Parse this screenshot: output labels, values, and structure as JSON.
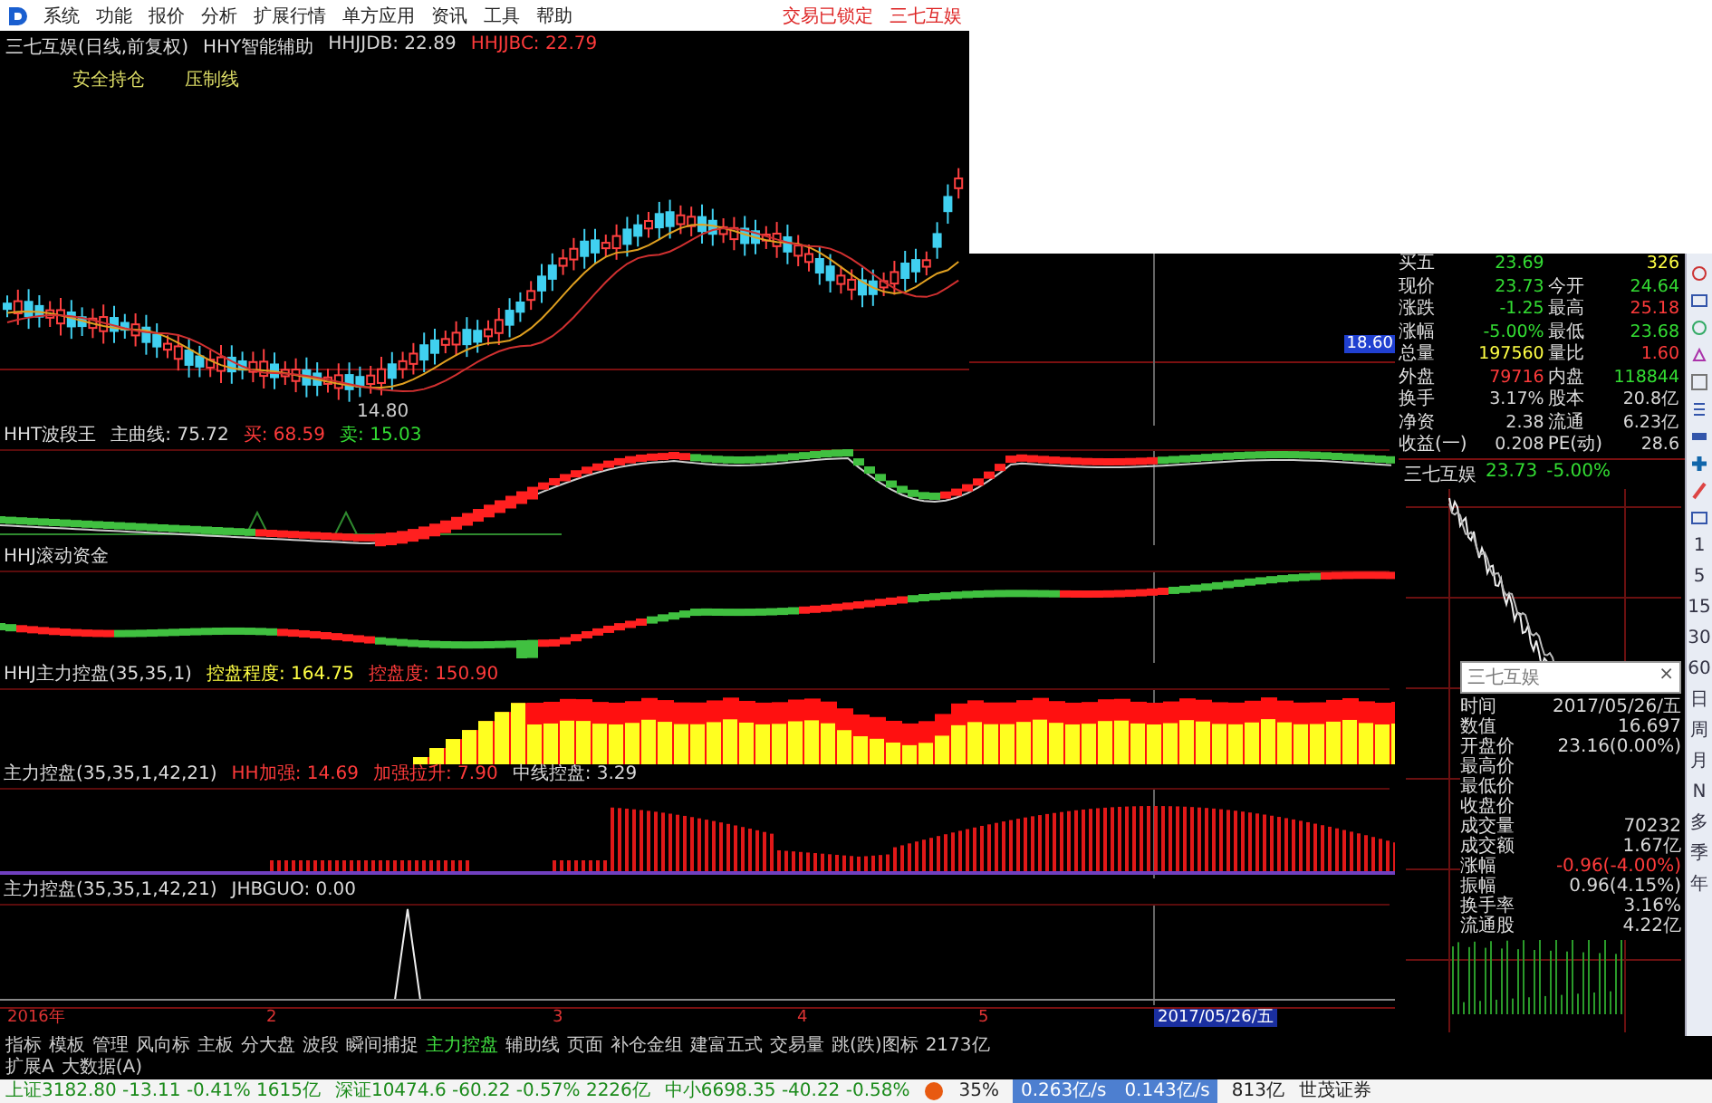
{
  "menu_bar": {
    "items": [
      "系统",
      "功能",
      "报价",
      "分析",
      "扩展行情",
      "单方应用",
      "资讯",
      "工具",
      "帮助"
    ],
    "right_items": [
      "交易已锁定",
      "三七互娱"
    ]
  },
  "chart_header": {
    "title": "三七互娱(日线,前复权)",
    "indicator": "HHY智能辅助",
    "values": [
      {
        "text": "HHJJDB: 22.89",
        "color": "#d8d8d8"
      },
      {
        "text": "HHJJBC: 22.79",
        "color": "#ff3b3b"
      }
    ],
    "legend": [
      "安全持仓",
      "压制线"
    ],
    "low_price": "14.80"
  },
  "price_axis_marker": "18.60",
  "panels": [
    {
      "kind": "wave",
      "name": "HHT波段王",
      "values": [
        {
          "text": "主曲线: 75.72",
          "color": "#d8d8d8"
        },
        {
          "text": "买: 68.59",
          "color": "#ff3b3b"
        },
        {
          "text": "卖: 15.03",
          "color": "#33dd33"
        }
      ]
    },
    {
      "kind": "flow",
      "name": "HHJ滚动资金"
    },
    {
      "kind": "control",
      "name": "HHJ主力控盘(35,35,1)",
      "values": [
        {
          "text": "控盘程度: 164.75",
          "color": "#ffff44"
        },
        {
          "text": "控盘度: 150.90",
          "color": "#ff3b3b"
        }
      ]
    },
    {
      "kind": "boost",
      "name": "主力控盘(35,35,1,42,21)",
      "values": [
        {
          "text": "HH加强: 14.69",
          "color": "#ff3b3b"
        },
        {
          "text": "加强拉升: 7.90",
          "color": "#ff3b3b"
        },
        {
          "text": "中线控盘: 3.29",
          "color": "#d8d8d8"
        }
      ]
    },
    {
      "kind": "spike",
      "name": "主力控盘(35,35,1,42,21)",
      "values": [
        {
          "text": "JHBGUO: 0.00",
          "color": "#d8d8d8"
        }
      ]
    }
  ],
  "time_axis": {
    "labels": [
      "2016年",
      "2",
      "3",
      "4",
      "5"
    ],
    "cursor_date": "2017/05/26/五"
  },
  "quote": {
    "rows": [
      {
        "cells": [
          {
            "label": "买五",
            "value": "23.69",
            "color": "#33dd33"
          },
          {
            "value": "326",
            "color": "#ffff44"
          }
        ]
      },
      {
        "cells": [
          {
            "label": "现价",
            "value": "23.73",
            "color": "#33dd33"
          },
          {
            "label": "今开",
            "value": "24.64",
            "color": "#33dd33"
          }
        ]
      },
      {
        "cells": [
          {
            "label": "涨跌",
            "value": "-1.25",
            "color": "#33dd33"
          },
          {
            "label": "最高",
            "value": "25.18",
            "color": "#ff3b3b"
          }
        ]
      },
      {
        "cells": [
          {
            "label": "涨幅",
            "value": "-5.00%",
            "color": "#33dd33"
          },
          {
            "label": "最低",
            "value": "23.68",
            "color": "#33dd33"
          }
        ]
      },
      {
        "cells": [
          {
            "label": "总量",
            "value": "197560",
            "color": "#ffff44"
          },
          {
            "label": "量比",
            "value": "1.60",
            "color": "#ff3b3b"
          }
        ]
      },
      {
        "cells": [
          {
            "label": "外盘",
            "value": "79716",
            "color": "#ff3b3b"
          },
          {
            "label": "内盘",
            "value": "118844",
            "color": "#33dd33"
          }
        ]
      },
      {
        "cells": [
          {
            "label": "换手",
            "value": "3.17%",
            "color": "#d8d8d8"
          },
          {
            "label": "股本",
            "value": "20.8亿",
            "color": "#d8d8d8"
          }
        ]
      },
      {
        "cells": [
          {
            "label": "净资",
            "value": "2.38",
            "color": "#d8d8d8"
          },
          {
            "label": "流通",
            "value": "6.23亿",
            "color": "#d8d8d8"
          }
        ]
      },
      {
        "cells": [
          {
            "label": "收益(一)",
            "value": "0.208",
            "color": "#d8d8d8"
          },
          {
            "label": "PE(动)",
            "value": "28.6",
            "color": "#d8d8d8"
          }
        ]
      }
    ],
    "stock": "三七互娱",
    "price": "23.73",
    "change": "-5.00%"
  },
  "popup": {
    "title": "三七互娱",
    "close": "×",
    "rows": [
      {
        "label": "时间",
        "value": "2017/05/26/五",
        "color": "#d8d8d8"
      },
      {
        "label": "数值",
        "value": "16.697",
        "color": "#d8d8d8"
      },
      {
        "label": "开盘价",
        "value": "23.16(0.00%)",
        "color": "#d8d8d8"
      },
      {
        "label": "最高价"
      },
      {
        "label": "最低价"
      },
      {
        "label": "收盘价"
      },
      {
        "label": "成交量",
        "value": "70232",
        "color": "#d8d8d8"
      },
      {
        "label": "成交额",
        "value": "1.67亿",
        "color": "#d8d8d8"
      },
      {
        "label": "涨幅",
        "value": "-0.96(-4.00%)",
        "color": "#ff3b3b"
      },
      {
        "label": "振幅",
        "value": "0.96(4.15%)",
        "color": "#d8d8d8"
      },
      {
        "label": "换手率",
        "value": "3.16%",
        "color": "#d8d8d8"
      },
      {
        "label": "流通股",
        "value": "4.22亿",
        "color": "#d8d8d8"
      }
    ]
  },
  "period_buttons": [
    "1",
    "5",
    "15",
    "30",
    "60",
    "日",
    "周",
    "月",
    "N",
    "多",
    "季",
    "年"
  ],
  "tabs": [
    {
      "label": "指标",
      "selected": false
    },
    {
      "label": "模板",
      "selected": false
    },
    {
      "label": "管理",
      "selected": false
    },
    {
      "label": "风向标",
      "selected": false
    },
    {
      "label": "主板",
      "selected": false
    },
    {
      "label": "分大盘",
      "selected": false
    },
    {
      "label": "波段",
      "selected": false
    },
    {
      "label": "瞬间捕捉",
      "selected": false
    },
    {
      "label": "主力控盘",
      "selected": true
    },
    {
      "label": "辅助线",
      "selected": false
    },
    {
      "label": "页面",
      "selected": false
    },
    {
      "label": "补仓金组",
      "selected": false
    },
    {
      "label": "建富五式",
      "selected": false
    },
    {
      "label": "交易量",
      "selected": false
    },
    {
      "label": "跳(跌)图标",
      "selected": false
    },
    {
      "label": "2173亿",
      "selected": false
    }
  ],
  "sub_tabs": [
    "扩展A",
    "大数据(A)"
  ],
  "status_bar": {
    "indices": [
      "上证3182.80 -13.11 -0.41% 1615亿",
      "深证10474.6 -60.22 -0.57% 2226亿",
      "中小6698.35 -40.22 -0.58%"
    ],
    "battery": "35%",
    "rates": [
      "0.263亿/s",
      "0.143亿/s"
    ],
    "amount": "813亿",
    "broker": "世茂证券"
  }
}
